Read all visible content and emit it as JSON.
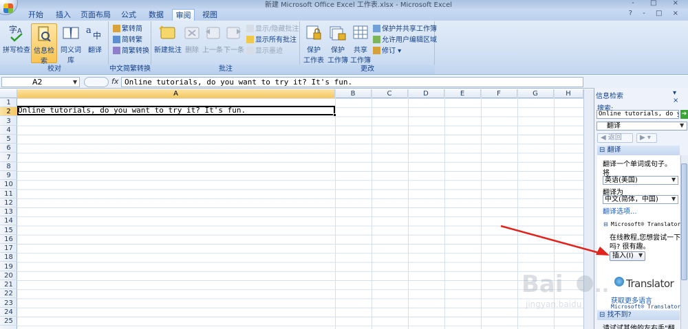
{
  "window": {
    "title": "新建 Microsoft Office Excel 工作表.xlsx - Microsoft Excel",
    "controls": "- □ ×",
    "help": "? - □ ×"
  },
  "tabs": [
    "开始",
    "插入",
    "页面布局",
    "公式",
    "数据",
    "审阅",
    "视图"
  ],
  "active_tab": "审阅",
  "ribbon": {
    "proofing": {
      "label": "校对",
      "spelling": "拼写检查",
      "research": "信息检索",
      "thesaurus": "同义词库",
      "translate": "翻译"
    },
    "chinese": {
      "label": "中文简繁转换",
      "to_simplified": "繁转简",
      "to_traditional": "简转繁",
      "convert": "简繁转换"
    },
    "comments": {
      "label": "批注",
      "new": "新建批注",
      "delete": "删除",
      "prev": "上一条",
      "next": "下一条",
      "show_hide": "显示/隐藏批注",
      "show_all": "显示所有批注",
      "show_ink": "显示墨迹"
    },
    "changes": {
      "label": "更改",
      "protect_sheet": [
        "保护",
        "工作表"
      ],
      "protect_workbook": [
        "保护",
        "工作簿 ▾"
      ],
      "share_workbook": [
        "共享",
        "工作簿"
      ],
      "protect_share": "保护并共享工作簿",
      "allow_edit": "允许用户编辑区域",
      "track": "修订 ▾"
    }
  },
  "formula_bar": {
    "name_box": "A2",
    "fx": "fx",
    "content": "Online tutorials, do you want to try it? It's fun."
  },
  "grid": {
    "columns": [
      "A",
      "B",
      "C",
      "D",
      "E",
      "F",
      "G",
      "H"
    ],
    "rows": [
      "1",
      "2",
      "3",
      "4",
      "5",
      "6",
      "7",
      "8",
      "9",
      "10",
      "11",
      "12",
      "13",
      "14",
      "15",
      "16",
      "17",
      "18",
      "19",
      "20",
      "21",
      "22",
      "23",
      "24",
      "25"
    ],
    "active_cell": "A2",
    "cell_a2": "Online tutorials, do you want to try it? It's fun."
  },
  "research_pane": {
    "title": "信息检索",
    "close": "▾ ×",
    "search_label": "搜索:",
    "search_value": "Online tutorials, do you w",
    "go": "➔",
    "service": "翻译",
    "back": "返回",
    "translate_header": "翻译",
    "translate_hint": "翻译一个单词或句子。",
    "from_label": "将",
    "from_value": "英语(美国)",
    "to_label": "翻译为",
    "to_value": "中文(简体，中国)",
    "options": "翻译选项...",
    "ms_translator": "Microsoft® Translator",
    "result": "在线教程,您想尝试一下吗? 很有趣。",
    "insert": "插入(I)",
    "logo_text": "Translator",
    "more_languages": "获取更多语言",
    "ms_footer": "Microsoft® Translator",
    "not_found_header": "找不到?",
    "not_found_text": "请试试其他的左右手\"翻"
  }
}
